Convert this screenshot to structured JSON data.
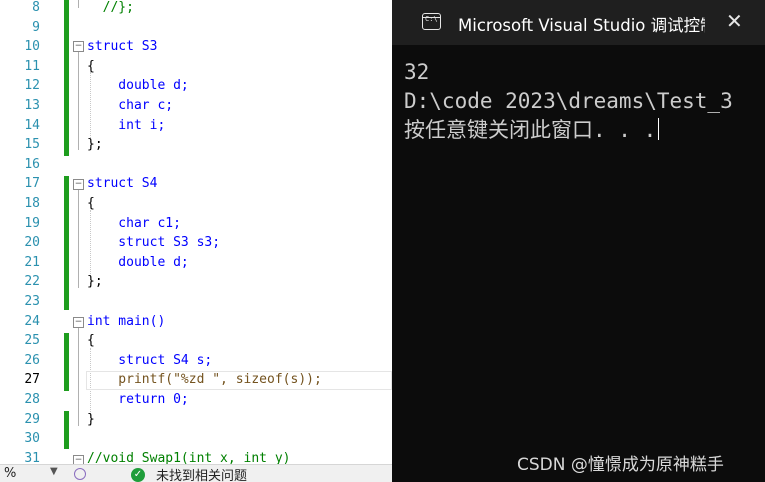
{
  "editor": {
    "lines": [
      {
        "num": "8",
        "code": "  //};"
      },
      {
        "num": "9",
        "code": ""
      },
      {
        "num": "10",
        "code": "struct S3"
      },
      {
        "num": "11",
        "code": "{"
      },
      {
        "num": "12",
        "code": "    double d;"
      },
      {
        "num": "13",
        "code": "    char c;"
      },
      {
        "num": "14",
        "code": "    int i;"
      },
      {
        "num": "15",
        "code": "};"
      },
      {
        "num": "16",
        "code": ""
      },
      {
        "num": "17",
        "code": "struct S4"
      },
      {
        "num": "18",
        "code": "{"
      },
      {
        "num": "19",
        "code": "    char c1;"
      },
      {
        "num": "20",
        "code": "    struct S3 s3;"
      },
      {
        "num": "21",
        "code": "    double d;"
      },
      {
        "num": "22",
        "code": "};"
      },
      {
        "num": "23",
        "code": ""
      },
      {
        "num": "24",
        "code": "int main()"
      },
      {
        "num": "25",
        "code": "{"
      },
      {
        "num": "26",
        "code": "    struct S4 s;"
      },
      {
        "num": "27",
        "code": "    printf(\"%zd \", sizeof(s));"
      },
      {
        "num": "28",
        "code": "    return 0;"
      },
      {
        "num": "29",
        "code": "}"
      },
      {
        "num": "30",
        "code": ""
      },
      {
        "num": "31",
        "code": "//void Swap1(int x, int y)"
      }
    ],
    "current_line": "27"
  },
  "status": {
    "zoom": "%",
    "message": "未找到相关问题"
  },
  "console": {
    "title": "Microsoft Visual Studio 调试控制台",
    "close_glyph": "✕",
    "output_line1": "32",
    "output_line2": "D:\\code 2023\\dreams\\Test_3",
    "output_line3": "按任意键关闭此窗口. . ."
  },
  "watermark": "CSDN @憧憬成为原神糕手",
  "colors": {
    "keyword": "#0000ff",
    "type": "#2b91af",
    "comment": "#008000",
    "string": "#a31515",
    "change_bar": "#1e9d1e",
    "console_bg": "#0c0c0c"
  }
}
